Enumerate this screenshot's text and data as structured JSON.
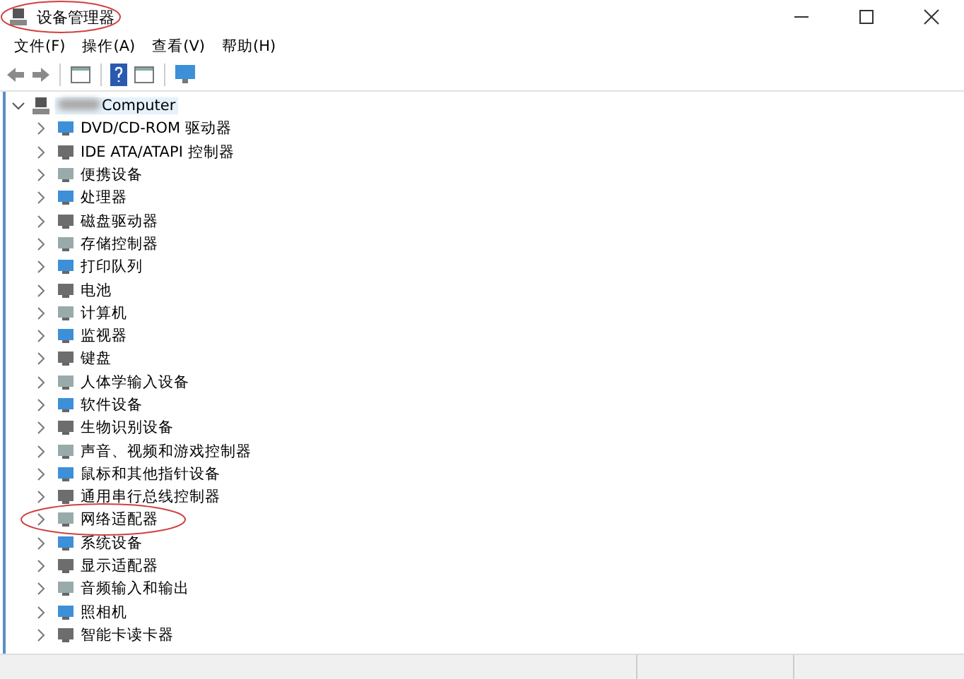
{
  "window": {
    "title": "设备管理器",
    "circled": true
  },
  "menu": [
    "文件(F)",
    "操作(A)",
    "查看(V)",
    "帮助(H)"
  ],
  "tree": {
    "label": "Computer",
    "expanded": true,
    "selected": true,
    "children": [
      {
        "label": "DVD/CD-ROM 驱动器",
        "circled": false
      },
      {
        "label": "IDE ATA/ATAPI 控制器",
        "circled": false
      },
      {
        "label": "便携设备",
        "circled": false
      },
      {
        "label": "处理器",
        "circled": false
      },
      {
        "label": "磁盘驱动器",
        "circled": false
      },
      {
        "label": "存储控制器",
        "circled": false
      },
      {
        "label": "打印队列",
        "circled": false
      },
      {
        "label": "电池",
        "circled": false
      },
      {
        "label": "计算机",
        "circled": false
      },
      {
        "label": "监视器",
        "circled": false
      },
      {
        "label": "键盘",
        "circled": false
      },
      {
        "label": "人体学输入设备",
        "circled": false
      },
      {
        "label": "软件设备",
        "circled": false
      },
      {
        "label": "生物识别设备",
        "circled": false
      },
      {
        "label": "声音、视频和游戏控制器",
        "circled": false
      },
      {
        "label": "鼠标和其他指针设备",
        "circled": false
      },
      {
        "label": "通用串行总线控制器",
        "circled": false
      },
      {
        "label": "网络适配器",
        "circled": true
      },
      {
        "label": "系统设备",
        "circled": false
      },
      {
        "label": "显示适配器",
        "circled": false
      },
      {
        "label": "音频输入和输出",
        "circled": false
      },
      {
        "label": "照相机",
        "circled": false
      },
      {
        "label": "智能卡读卡器",
        "circled": false
      }
    ]
  }
}
